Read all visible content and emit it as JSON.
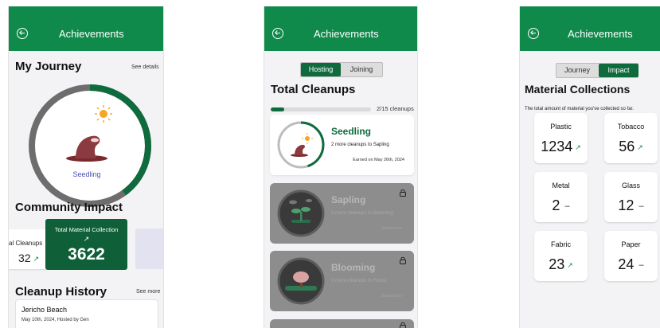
{
  "app": {
    "title": "Achievements"
  },
  "journey_screen": {
    "title": "My Journey",
    "see_details": "See details",
    "stage": "Seedling",
    "journey_progress": 0.4,
    "community": {
      "title": "Community Impact",
      "total_cleanups_label": "Total Cleanups",
      "total_cleanups_visible_label": "al Cleanups",
      "total_cleanups_value": "32",
      "total_material_label": "Total Material Collection",
      "total_material_value": "3622"
    },
    "history": {
      "title": "Cleanup History",
      "see_more": "See more",
      "items": [
        {
          "location": "Jericho Beach",
          "meta": "May 10th, 2024, Hosted by Gen"
        }
      ]
    }
  },
  "cleanups_screen": {
    "toggle": {
      "hosting": "Hosting",
      "joining": "Joining",
      "active": "hosting"
    },
    "title": "Total Cleanups",
    "progress_text": "2/15 cleanups",
    "progress_fraction": 0.1333,
    "stages": [
      {
        "name": "Seedling",
        "desc": "2 more cleanups to Sapling",
        "earned": "Earned on May 26th, 2024",
        "locked": false,
        "progress": 0.45
      },
      {
        "name": "Sapling",
        "desc": "3 more cleanups to Blooming",
        "earned": "Earned on -",
        "locked": true
      },
      {
        "name": "Blooming",
        "desc": "3 more cleanups to Forest",
        "earned": "Earned on -",
        "locked": true
      }
    ]
  },
  "impact_screen": {
    "toggle": {
      "journey": "Journey",
      "impact": "Impact",
      "active": "impact"
    },
    "title": "Material Collections",
    "subtitle": "The total amount of material you've collected so far.",
    "materials": [
      {
        "name": "Plastic",
        "value": "1234",
        "trend": "up"
      },
      {
        "name": "Tobacco",
        "value": "56",
        "trend": "up"
      },
      {
        "name": "Metal",
        "value": "2",
        "trend": "flat"
      },
      {
        "name": "Glass",
        "value": "12",
        "trend": "flat"
      },
      {
        "name": "Fabric",
        "value": "23",
        "trend": "up"
      },
      {
        "name": "Paper",
        "value": "24",
        "trend": "flat"
      }
    ]
  },
  "colors": {
    "brand_green": "#0f8a4a",
    "dark_green": "#0f5f38",
    "locked_gray": "#8d8d8d",
    "stage_text": "#4c4fb0"
  },
  "icons": {
    "back": "back-arrow-circle-icon",
    "trend_up": "trend-up-icon",
    "trend_flat": "dash-icon",
    "lock": "lock-icon",
    "sun": "sun-icon",
    "seedling": "seedling-icon"
  }
}
